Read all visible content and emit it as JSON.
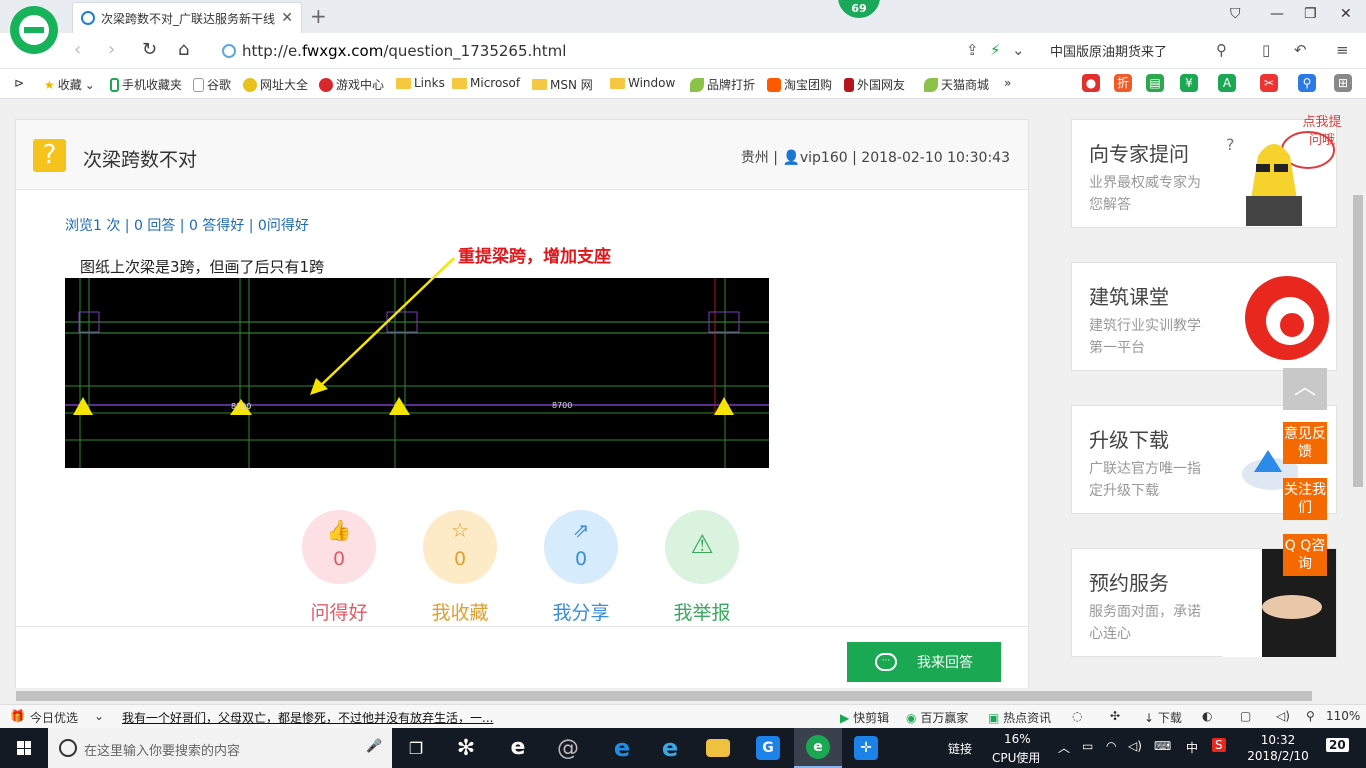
{
  "browser": {
    "tab_title": "次梁跨数不对_广联达服务新干线",
    "new_tab": "+",
    "badge": "69",
    "url": "http://e.fwxgx.com/question_1735265.html",
    "url_prefix": "http://e.",
    "url_domain": "fwxgx.com",
    "url_path": "/question_1735265.html",
    "news_ticker": "中国版原油期货来了"
  },
  "bookmarks": [
    {
      "label": "收藏",
      "icon": "star-icon"
    },
    {
      "label": "手机收藏夹",
      "icon": "phone-icon"
    },
    {
      "label": "谷歌",
      "icon": "page-icon"
    },
    {
      "label": "网址大全",
      "icon": "globe-icon"
    },
    {
      "label": "游戏中心",
      "icon": "game-icon"
    },
    {
      "label": "Links",
      "icon": "folder-icon"
    },
    {
      "label": "Microsof",
      "icon": "folder-icon"
    },
    {
      "label": "MSN 网",
      "icon": "folder-icon"
    },
    {
      "label": "Window",
      "icon": "folder-icon"
    },
    {
      "label": "品牌打折",
      "icon": "leaf-icon"
    },
    {
      "label": "淘宝团购",
      "icon": "taobao-icon"
    },
    {
      "label": "外国网友",
      "icon": "book-icon"
    },
    {
      "label": "天猫商城",
      "icon": "leaf-icon"
    }
  ],
  "bookmark_more": "»",
  "question": {
    "title": "次梁跨数不对",
    "region": "贵州",
    "user": "vip160",
    "datetime": "2018-02-10 10:30:43",
    "meta_sep": " | ",
    "stats": "浏览1 次 | 0 回答 | 0 答得好 | 0问得好",
    "description": "图纸上次梁是3跨，但画了后只有1跨",
    "annotation": "重提梁跨，增加支座",
    "cad_labels": [
      "8700",
      "8700"
    ]
  },
  "actions": [
    {
      "count": "0",
      "label": "问得好",
      "color": "#e05a6a",
      "bg": "#fde0e4",
      "icon": "thumbs-up-icon"
    },
    {
      "count": "0",
      "label": "我收藏",
      "color": "#e0a030",
      "bg": "#fdebc8",
      "icon": "star-icon"
    },
    {
      "count": "0",
      "label": "我分享",
      "color": "#3a8ed8",
      "bg": "#d6ebfb",
      "icon": "share-icon"
    },
    {
      "count": "0",
      "label": "我举报",
      "color": "#3aa860",
      "bg": "#d9f3df",
      "icon": "warning-icon"
    }
  ],
  "answer_button": "我来回答",
  "side_panels": [
    {
      "title": "向专家提问",
      "desc": "业界最权威专家为您解答",
      "bubble": "点我提问哦"
    },
    {
      "title": "建筑课堂",
      "desc": "建筑行业实训教学第一平台"
    },
    {
      "title": "升级下载",
      "desc": "广联达官方唯一指定升级下载"
    },
    {
      "title": "预约服务",
      "desc": "服务面对面，承诺心连心"
    }
  ],
  "float_buttons": [
    "意见反馈",
    "关注我们",
    "Q Q咨询"
  ],
  "statusbar": {
    "daily": "今日优选",
    "headline": "我有一个好哥们，父母双亡，都是惨死，不过他并没有放弃生活，一...",
    "items": [
      "快剪辑",
      "百万赢家",
      "热点资讯",
      "下载"
    ],
    "zoom": "110%"
  },
  "taskbar": {
    "search_placeholder": "在这里输入你要搜索的内容",
    "tray_link": "链接",
    "cpu_percent": "16%",
    "cpu_label": "CPU使用",
    "ime": "中",
    "time": "10:32",
    "date": "2018/2/10",
    "notifications": "20"
  }
}
